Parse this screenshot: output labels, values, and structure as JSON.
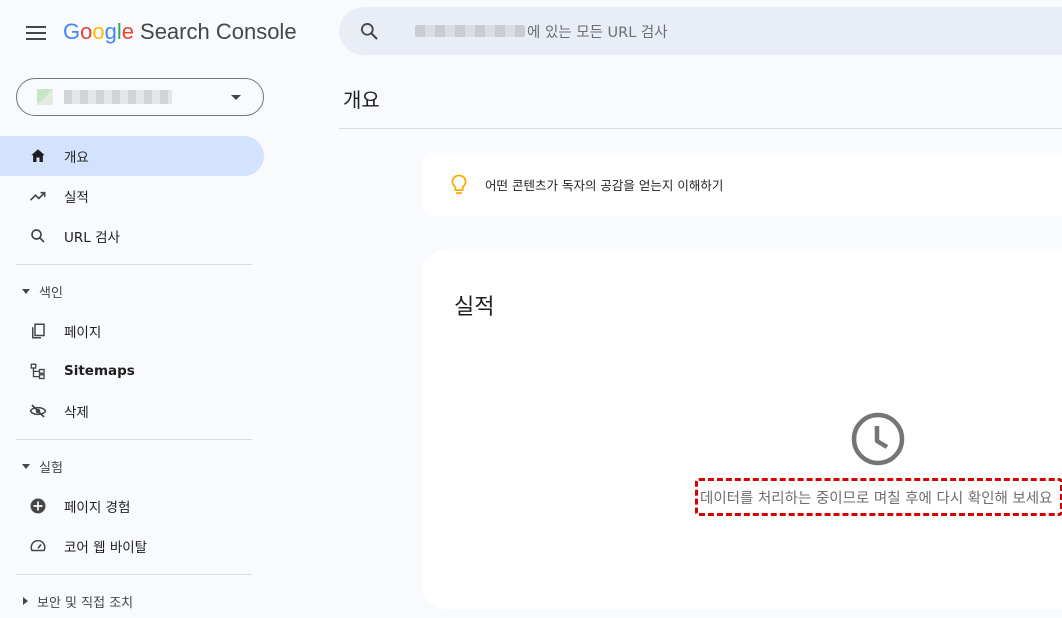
{
  "header": {
    "menu_icon": "hamburger-menu-icon",
    "logo_letters": [
      "G",
      "o",
      "o",
      "g",
      "l",
      "e"
    ],
    "logo_rest": "Search Console",
    "search_placeholder": "에 있는 모든 URL 검사"
  },
  "property": {
    "name": "",
    "caret_icon": "dropdown-arrow-icon"
  },
  "sidebar": {
    "items": [
      {
        "label": "개요",
        "icon": "home-icon",
        "active": true
      },
      {
        "label": "실적",
        "icon": "trending-up-icon"
      },
      {
        "label": "URL 검사",
        "icon": "search-icon"
      }
    ],
    "sections": [
      {
        "label": "색인",
        "expanded": true,
        "items": [
          {
            "label": "페이지",
            "icon": "pages-icon"
          },
          {
            "label": "Sitemaps",
            "icon": "sitemap-icon"
          },
          {
            "label": "삭제",
            "icon": "eye-off-icon"
          }
        ]
      },
      {
        "label": "실험",
        "expanded": true,
        "items": [
          {
            "label": "페이지 경험",
            "icon": "plus-circle-icon"
          },
          {
            "label": "코어 웹 바이탈",
            "icon": "speedometer-icon"
          }
        ]
      },
      {
        "label": "보안 및 직접 조치",
        "expanded": false,
        "items": []
      }
    ]
  },
  "main": {
    "page_title": "개요",
    "tip_text": "어떤 콘텐츠가 독자의 공감을 얻는지 이해하기",
    "tip_icon": "lightbulb-icon",
    "performance": {
      "title": "실적",
      "status_icon": "clock-icon",
      "status_text": "데이터를 처리하는 중이므로 며칠 후에 다시 확인해 보세요"
    }
  },
  "colors": {
    "active_nav_bg": "#d3e3fd",
    "search_bg": "#e9eef6",
    "highlight_border": "#d50000",
    "bulb": "#f9ab00"
  }
}
